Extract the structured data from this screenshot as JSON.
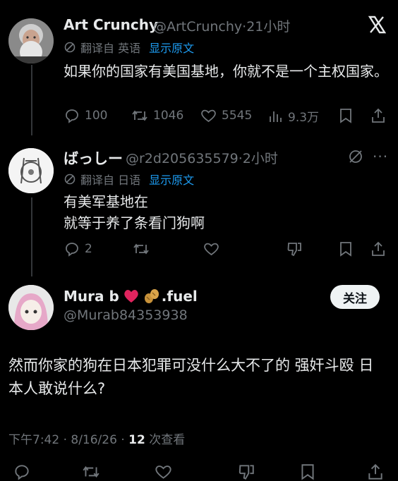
{
  "tweet1": {
    "name": "Art Crunchy",
    "handle": "@ArtCrunchy",
    "time": "·21小时",
    "translated_prefix": "翻译自 英语",
    "show_original": "显示原文",
    "text": "如果你的国家有美国基地，你就不是一个主权国家。",
    "replies": "100",
    "retweets": "1046",
    "likes": "5545",
    "views": "9.3万"
  },
  "tweet2": {
    "name": "ばっしー",
    "handle": "@r2d205635579",
    "time": "·2小时",
    "translated_prefix": "翻译自 日语",
    "show_original": "显示原文",
    "text_line1": "有美军基地在",
    "text_line2": "就等于养了条看门狗啊",
    "replies": "2"
  },
  "tweet3": {
    "name": "Mura b",
    "name_suffix": ".fuel",
    "handle": "@Murab84353938",
    "follow_label": "关注",
    "text": "然而你家的狗在日本犯罪可没什么大不了的 强奸斗殴 日本人敢说什么?",
    "timestamp": "下午7:42 · 8/16/26 · ",
    "view_count": "12",
    "view_label": " 次查看"
  },
  "icons": {
    "x_logo": "x-logo-icon",
    "translate": "translate-icon",
    "reply": "reply-icon",
    "retweet": "retweet-icon",
    "like": "heart-icon",
    "views": "views-icon",
    "bookmark": "bookmark-icon",
    "share": "share-icon",
    "grok": "grok-icon",
    "dislike": "dislike-icon",
    "emoji_heart": "red-heart-icon",
    "emoji_peanut": "peanut-icon"
  },
  "colors": {
    "background": "#000000",
    "text": "#e7e9ea",
    "muted": "#71767b",
    "link": "#1d9bf0",
    "heart": "#e0245e"
  }
}
